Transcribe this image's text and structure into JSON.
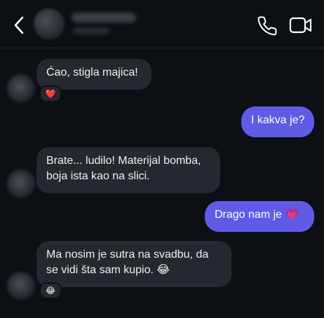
{
  "header": {
    "contact_name": "",
    "contact_status": ""
  },
  "messages": [
    {
      "direction": "incoming",
      "text": "Ćao, stigla majica!",
      "reaction": "❤️"
    },
    {
      "direction": "outgoing",
      "text": "I kakva je?"
    },
    {
      "direction": "incoming",
      "line1": "Brate... ludilo! Materijal bomba,",
      "line2": "boja ista kao na slici."
    },
    {
      "direction": "outgoing",
      "text": "Drago nam je",
      "emoji": "💗"
    },
    {
      "direction": "incoming",
      "line1": "Ma nosim je sutra na svadbu, da",
      "line2": "se vidi šta sam kupio.",
      "emoji": "😂",
      "reaction": "😂"
    }
  ],
  "colors": {
    "background": "#0c0f14",
    "incoming_bubble": "#25282e",
    "outgoing_bubble": "#5e5ce6",
    "icon": "#ffffff"
  },
  "icons": {
    "back": "chevron-left-icon",
    "call": "phone-icon",
    "video": "video-camera-icon"
  }
}
